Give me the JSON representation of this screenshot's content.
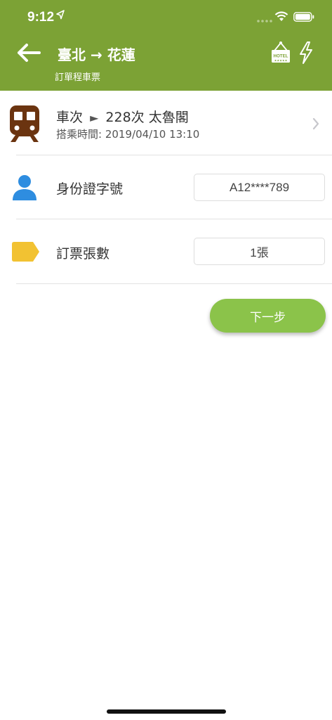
{
  "status_bar": {
    "time": "9:12"
  },
  "header": {
    "title_from": "臺北",
    "title_arrow": "→",
    "title_to": "花蓮",
    "subtitle": "訂單程車票",
    "hotel_icon_text": "HOTEL"
  },
  "train": {
    "prefix": "車次",
    "arrow": "►",
    "number": "228次",
    "name": "太魯閣",
    "time_label": "搭乘時間:",
    "time_value": "2019/04/10 13:10"
  },
  "id_row": {
    "label": "身份證字號",
    "value": "A12****789"
  },
  "ticket_row": {
    "label": "訂票張數",
    "value": "1張"
  },
  "next_button": {
    "label": "下一步"
  },
  "colors": {
    "header_bg": "#7ca235",
    "button_bg": "#8bc34a",
    "train_icon": "#6b3410",
    "person_icon": "#2e8de0",
    "tag_icon": "#f2c232"
  },
  "icons": [
    "back-arrow-icon",
    "hotel-icon",
    "flash-icon",
    "train-icon",
    "person-icon",
    "tag-icon",
    "chevron-right-icon"
  ]
}
